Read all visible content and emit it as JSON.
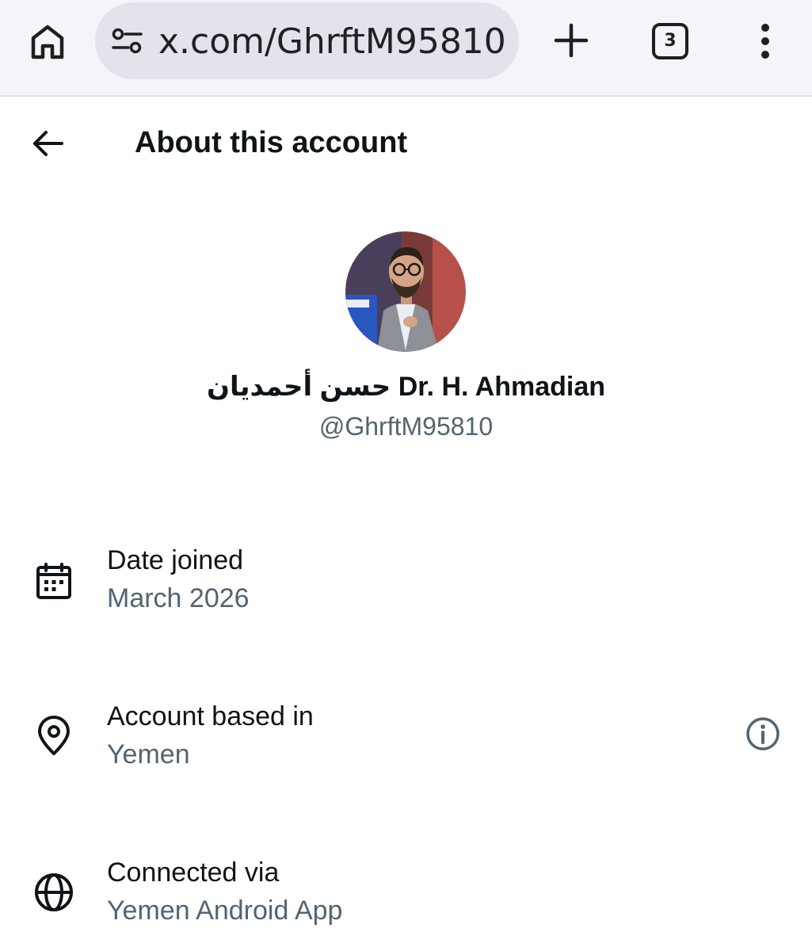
{
  "browser": {
    "url": "x.com/GhrftM95810",
    "tab_count": "3",
    "icons": {
      "home": "home-icon",
      "site_settings": "tune-icon",
      "new_tab": "plus-icon",
      "tabs": "tab-switcher-icon",
      "menu": "more-vert-icon"
    }
  },
  "header": {
    "title": "About this account",
    "back_icon": "arrow-left-icon"
  },
  "profile": {
    "display_name": "حسن أحمديان Dr. H. Ahmadian",
    "handle": "@GhrftM95810"
  },
  "rows": [
    {
      "label": "Date joined",
      "value": "March 2026",
      "icon": "calendar-icon"
    },
    {
      "label": "Account based in",
      "value": "Yemen",
      "icon": "location-pin-icon",
      "trailing_icon": "info-icon"
    },
    {
      "label": "Connected via",
      "value": "Yemen Android App",
      "icon": "globe-icon"
    }
  ],
  "colors": {
    "text_primary": "#0f1419",
    "text_secondary": "#536471",
    "chrome_bg": "#f4f4f9",
    "url_pill_bg": "#e3e3ec"
  }
}
